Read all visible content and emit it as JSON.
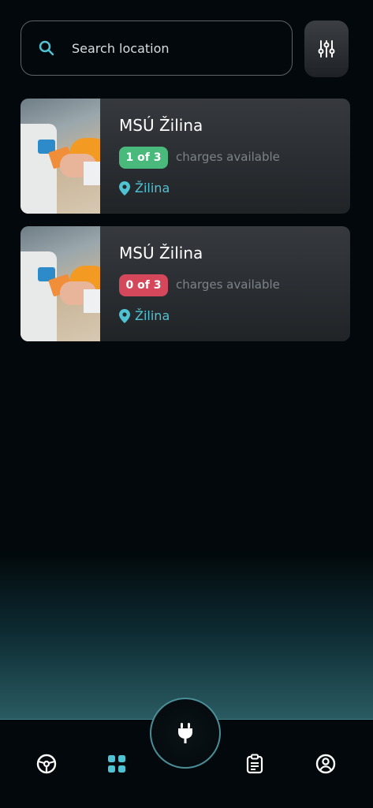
{
  "search": {
    "placeholder": "Search location"
  },
  "filter": {
    "icon": "sliders-icon"
  },
  "colors": {
    "accent": "#4fc3d3",
    "available": "#49b97c",
    "unavailable": "#d5485b"
  },
  "stations": [
    {
      "name": "MSÚ Žilina",
      "badge": "1 of 3",
      "badge_status": "available",
      "charges_label": "charges available",
      "location": "Žilina"
    },
    {
      "name": "MSÚ Žilina",
      "badge": "0 of 3",
      "badge_status": "unavailable",
      "charges_label": "charges available",
      "location": "Žilina"
    }
  ],
  "nav": {
    "items": [
      {
        "icon": "steering-wheel-icon"
      },
      {
        "icon": "grid-icon",
        "active": true
      },
      {
        "icon": "plug-icon"
      },
      {
        "icon": "clipboard-icon"
      },
      {
        "icon": "profile-icon"
      }
    ]
  }
}
